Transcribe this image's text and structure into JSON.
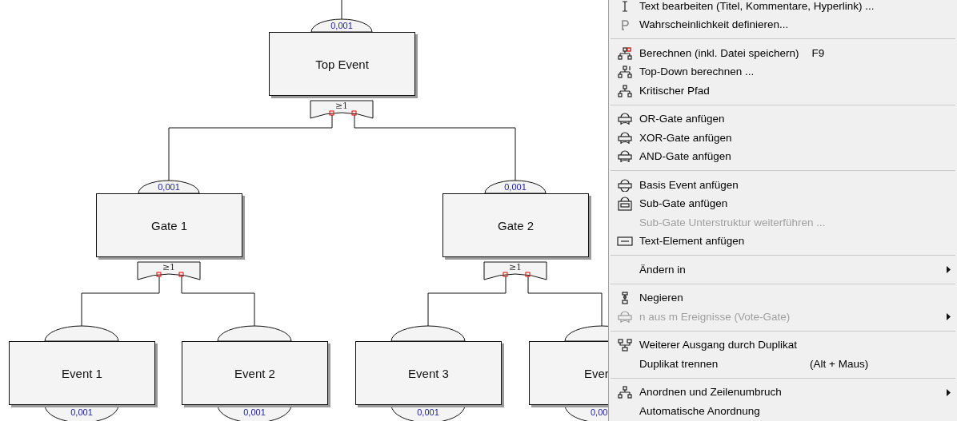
{
  "tree": {
    "kind": "gate",
    "label": "Top Event",
    "value": "0,001",
    "gate": "≥1",
    "children": [
      {
        "kind": "gate",
        "label": "Gate 1",
        "value": "0,001",
        "gate": "≥1",
        "children": [
          {
            "kind": "event",
            "label": "Event 1",
            "value": "0,001",
            "cut": false
          },
          {
            "kind": "event",
            "label": "Event 2",
            "value": "0,001",
            "cut": false
          }
        ]
      },
      {
        "kind": "gate",
        "label": "Gate 2",
        "value": "0,001",
        "gate": "≥1",
        "children": [
          {
            "kind": "event",
            "label": "Event 3",
            "value": "0,001",
            "cut": false
          },
          {
            "kind": "event",
            "label": "Ever",
            "value": "0,00",
            "cut": true
          }
        ]
      }
    ]
  },
  "menu": [
    {
      "kind": "cursor",
      "label": "Text bearbeiten (Titel, Kommentare, Hyperlink) ...",
      "disabled": false
    },
    {
      "kind": "letter",
      "label": "Wahrscheinlichkeit definieren...",
      "disabled": false
    },
    {
      "kind": "separator"
    },
    {
      "kind": "calc",
      "label": "Berechnen  (inkl. Datei speichern)",
      "shortcut": "F9",
      "disabled": false
    },
    {
      "kind": "topdown",
      "label": "Top-Down berechnen ...",
      "disabled": false
    },
    {
      "kind": "path",
      "label": "Kritischer Pfad",
      "disabled": false
    },
    {
      "kind": "separator"
    },
    {
      "kind": "gate",
      "label": "OR-Gate anfügen",
      "disabled": false
    },
    {
      "kind": "gate",
      "label": "XOR-Gate anfügen",
      "disabled": false
    },
    {
      "kind": "gate",
      "label": "AND-Gate anfügen",
      "disabled": false
    },
    {
      "kind": "separator"
    },
    {
      "kind": "basic",
      "label": "Basis Event anfügen",
      "disabled": false
    },
    {
      "kind": "subgate",
      "label": "Sub-Gate anfügen",
      "disabled": false
    },
    {
      "kind": "plain",
      "label": "Sub-Gate Unterstruktur weiterführen ...",
      "disabled": true
    },
    {
      "kind": "textel",
      "label": "Text-Element anfügen",
      "disabled": false
    },
    {
      "kind": "separator"
    },
    {
      "kind": "plain",
      "label": "Ändern in",
      "submenu": true,
      "disabled": false
    },
    {
      "kind": "separator"
    },
    {
      "kind": "negate",
      "label": "Negieren",
      "disabled": false
    },
    {
      "kind": "gate",
      "label": "n aus m Ereignisse (Vote-Gate)",
      "submenu": true,
      "disabled": true
    },
    {
      "kind": "separator"
    },
    {
      "kind": "duplicate",
      "label": "Weiterer Ausgang durch Duplikat",
      "disabled": false
    },
    {
      "kind": "plain",
      "label": "Duplikat trennen",
      "shortcut": "(Alt + Maus)",
      "disabled": false
    },
    {
      "kind": "separator"
    },
    {
      "kind": "arrange",
      "label": "Anordnen und Zeilenumbruch",
      "submenu": true,
      "disabled": false
    },
    {
      "kind": "plain",
      "label": "Automatische Anordnung",
      "disabled": false
    }
  ]
}
